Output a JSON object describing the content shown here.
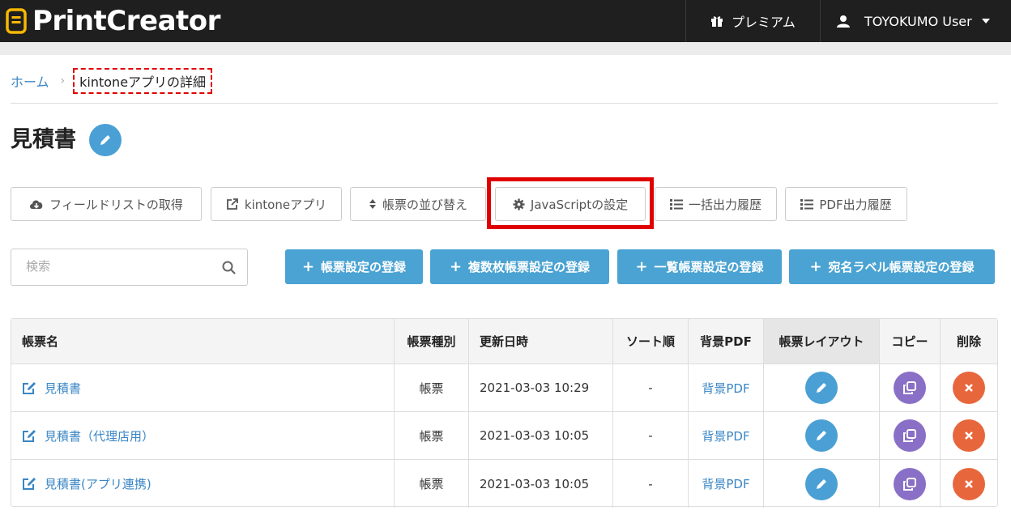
{
  "header": {
    "brand": "PrintCreator",
    "premium_label": "プレミアム",
    "user_label": "TOYOKUMO User"
  },
  "breadcrumb": {
    "home": "ホーム",
    "separator": "›",
    "current": "kintoneアプリの詳細"
  },
  "page": {
    "title": "見積書"
  },
  "toolbar": {
    "fetch_fields": "フィールドリストの取得",
    "kintone_app": "kintoneアプリ",
    "sort_forms": "帳票の並び替え",
    "javascript_settings": "JavaScriptの設定",
    "bulk_history": "一括出力履歴",
    "pdf_history": "PDF出力履歴"
  },
  "search": {
    "placeholder": "検索",
    "value": ""
  },
  "actions": {
    "register_form": "帳票設定の登録",
    "register_multi_form": "複数枚帳票設定の登録",
    "register_list_form": "一覧帳票設定の登録",
    "register_label_form": "宛名ラベル帳票設定の登録"
  },
  "table": {
    "headers": {
      "name": "帳票名",
      "type": "帳票種別",
      "updated": "更新日時",
      "sort": "ソート順",
      "bg_pdf": "背景PDF",
      "layout": "帳票レイアウト",
      "copy": "コピー",
      "delete": "削除"
    },
    "rows": [
      {
        "name": "見積書",
        "type": "帳票",
        "updated": "2021-03-03 10:29",
        "sort": "-",
        "bg_pdf": "背景PDF"
      },
      {
        "name": "見積書（代理店用）",
        "type": "帳票",
        "updated": "2021-03-03 10:05",
        "sort": "-",
        "bg_pdf": "背景PDF"
      },
      {
        "name": "見積書(アプリ連携)",
        "type": "帳票",
        "updated": "2021-03-03 10:05",
        "sort": "-",
        "bg_pdf": "背景PDF"
      }
    ]
  },
  "colors": {
    "topbar": "#1f1f1f",
    "brand_accent": "#f5b800",
    "primary": "#4aa3d2",
    "link": "#3a86c4",
    "copy": "#8a6fc7",
    "delete": "#e8663c",
    "highlight": "#e00000"
  },
  "icons": {
    "brand": "document-logo-icon",
    "premium": "gift-icon",
    "user": "user-icon",
    "title_edit": "pencil-icon",
    "fetch_fields": "cloud-download-icon",
    "kintone_app": "external-link-icon",
    "sort_forms": "sort-icon",
    "javascript_settings": "gear-icon",
    "bulk_history": "list-icon",
    "pdf_history": "list-icon",
    "search": "search-icon",
    "row_edit": "edit-icon",
    "layout": "pencil-icon",
    "copy": "copy-icon",
    "delete": "close-icon"
  }
}
